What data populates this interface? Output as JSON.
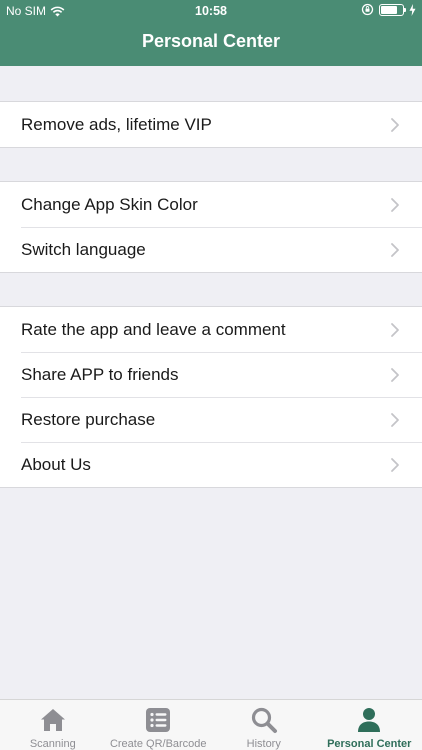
{
  "status_bar": {
    "carrier": "No SIM",
    "time": "10:58",
    "battery_level": 0.75
  },
  "header": {
    "title": "Personal Center"
  },
  "groups": [
    {
      "items": [
        {
          "label": "Remove ads, lifetime VIP"
        }
      ]
    },
    {
      "items": [
        {
          "label": "Change App Skin Color"
        },
        {
          "label": "Switch language"
        }
      ]
    },
    {
      "items": [
        {
          "label": "Rate the app and leave a comment"
        },
        {
          "label": "Share APP to friends"
        },
        {
          "label": "Restore purchase"
        },
        {
          "label": "About Us"
        }
      ]
    }
  ],
  "tabbar": {
    "tabs": [
      {
        "label": "Scanning",
        "icon": "home-icon",
        "active": false
      },
      {
        "label": "Create QR/Barcode",
        "icon": "list-icon",
        "active": false
      },
      {
        "label": "History",
        "icon": "search-icon",
        "active": false
      },
      {
        "label": "Personal Center",
        "icon": "person-icon",
        "active": true
      }
    ]
  },
  "colors": {
    "brand": "#4a8c74",
    "active_tab": "#2f6e5a",
    "inactive_tab": "#8e8e93",
    "background": "#efeff4"
  }
}
